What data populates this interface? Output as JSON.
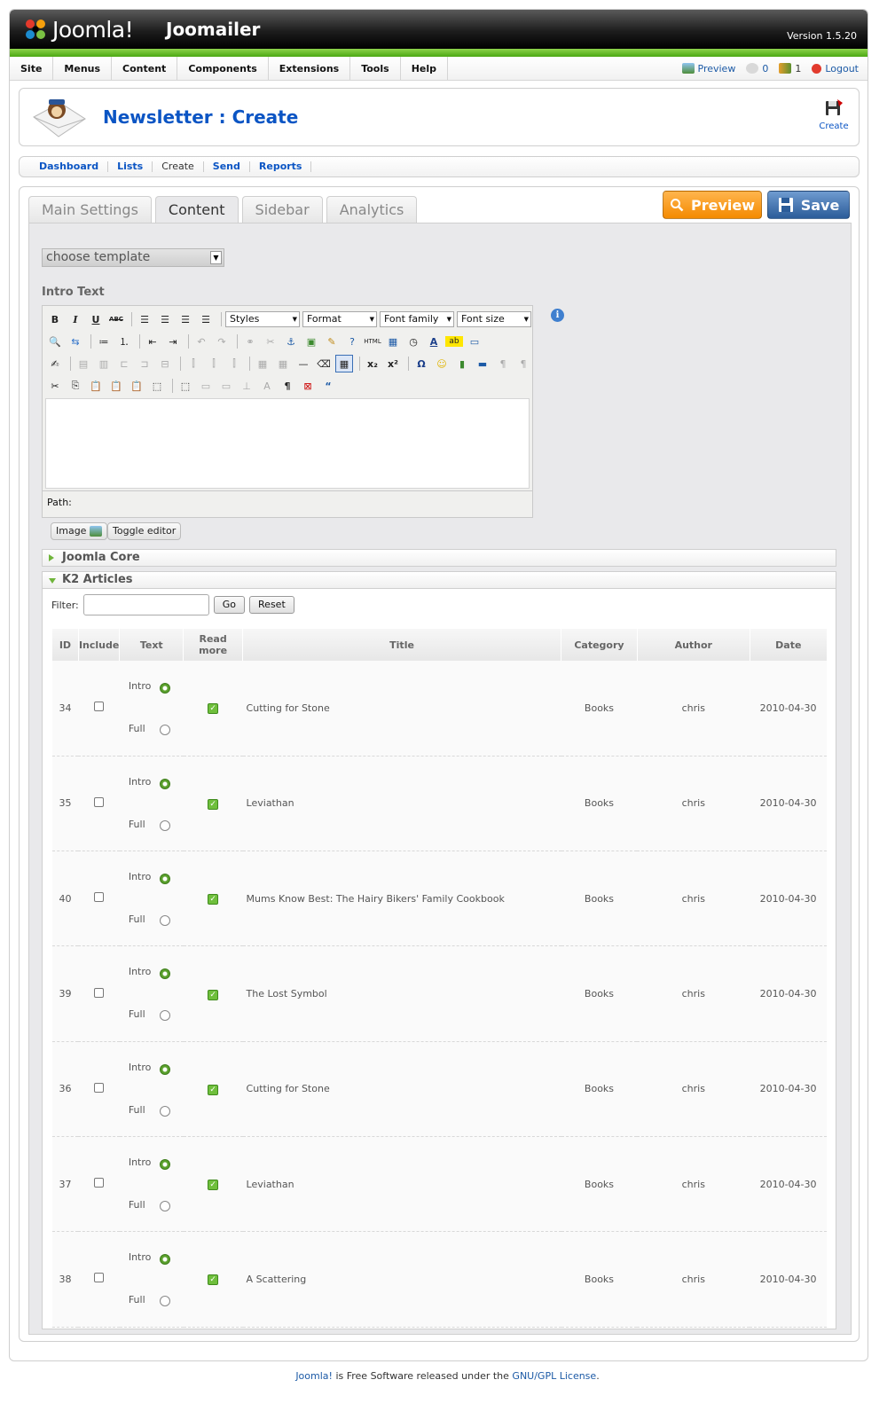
{
  "header": {
    "logo_text": "Joomla!",
    "app_name": "Joomailer",
    "version": "Version 1.5.20"
  },
  "menu": [
    "Site",
    "Menus",
    "Content",
    "Components",
    "Extensions",
    "Tools",
    "Help"
  ],
  "status": {
    "preview": "Preview",
    "messages": "0",
    "users": "1",
    "logout": "Logout"
  },
  "toolbar": {
    "title": "Newsletter : Create",
    "create_label": "Create"
  },
  "submenu": [
    "Dashboard",
    "Lists",
    "Create",
    "Send",
    "Reports"
  ],
  "tabs": [
    "Main Settings",
    "Content",
    "Sidebar",
    "Analytics"
  ],
  "buttons": {
    "preview": "Preview",
    "save": "Save"
  },
  "template_select": {
    "value": "choose template"
  },
  "intro": {
    "label": "Intro Text",
    "styles": "Styles",
    "format": "Format",
    "font_family": "Font family",
    "font_size": "Font size",
    "path_label": "Path:",
    "image_button": "Image",
    "toggle_button": "Toggle editor"
  },
  "sections": {
    "joomla_core": "Joomla Core",
    "k2_articles": "K2 Articles"
  },
  "filter": {
    "label": "Filter:",
    "go": "Go",
    "reset": "Reset"
  },
  "table": {
    "headers": [
      "ID",
      "Include",
      "Text",
      "Read more",
      "Title",
      "Category",
      "Author",
      "Date"
    ],
    "intro_label": "Intro",
    "full_label": "Full",
    "rows": [
      {
        "id": "34",
        "title": "Cutting for Stone",
        "category": "Books",
        "author": "chris",
        "date": "2010-04-30"
      },
      {
        "id": "35",
        "title": "Leviathan",
        "category": "Books",
        "author": "chris",
        "date": "2010-04-30"
      },
      {
        "id": "40",
        "title": "Mums Know Best: The Hairy Bikers' Family Cookbook",
        "category": "Books",
        "author": "chris",
        "date": "2010-04-30"
      },
      {
        "id": "39",
        "title": "The Lost Symbol",
        "category": "Books",
        "author": "chris",
        "date": "2010-04-30"
      },
      {
        "id": "36",
        "title": "Cutting for Stone",
        "category": "Books",
        "author": "chris",
        "date": "2010-04-30"
      },
      {
        "id": "37",
        "title": "Leviathan",
        "category": "Books",
        "author": "chris",
        "date": "2010-04-30"
      },
      {
        "id": "38",
        "title": "A Scattering",
        "category": "Books",
        "author": "chris",
        "date": "2010-04-30"
      }
    ]
  },
  "footer": {
    "joomla_link": "Joomla!",
    "middle": " is Free Software released under the ",
    "license_link": "GNU/GPL License",
    "end": "."
  }
}
